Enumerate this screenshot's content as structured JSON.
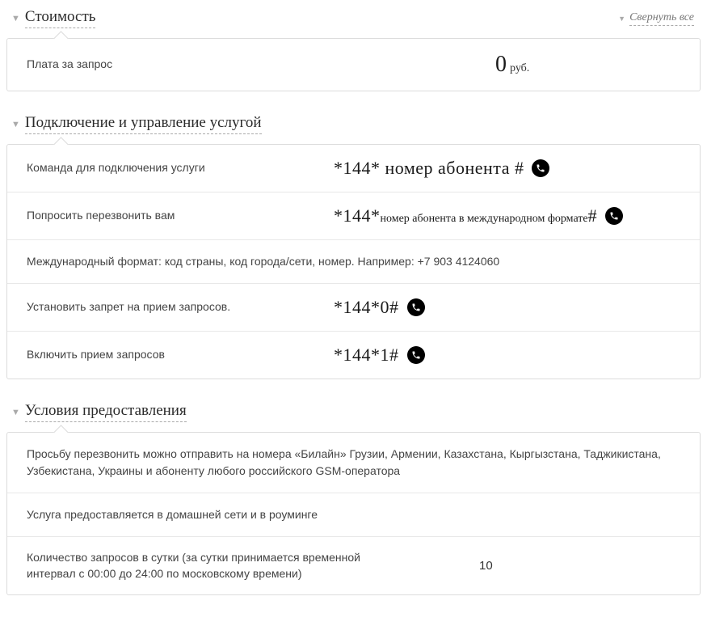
{
  "collapse_all": "Свернуть все",
  "sections": {
    "cost": {
      "title": "Стоимость",
      "rows": {
        "fee_label": "Плата за запрос",
        "fee_value": "0",
        "fee_unit": "руб."
      }
    },
    "manage": {
      "title": "Подключение и управление услугой",
      "rows": {
        "cmd_label": "Команда для подключения услуги",
        "cmd_code_a": "*144*",
        "cmd_code_b": "номер абонента",
        "cmd_code_c": "#",
        "callback_label": "Попросить перезвонить вам",
        "callback_code_a": "*144*",
        "callback_code_b": "номер абонента в международном формате",
        "callback_code_c": "#",
        "format_text": "Международный формат: код страны, код города/сети, номер. Например: +7 903 4124060",
        "block_label": "Установить запрет на прием запросов.",
        "block_code": "*144*0#",
        "enable_label": "Включить прием запросов",
        "enable_code": "*144*1#"
      }
    },
    "terms": {
      "title": "Условия предоставления",
      "rows": {
        "countries": "Просьбу перезвонить можно отправить на номера «Билайн» Грузии, Армении, Казахстана, Кыргызстана, Таджикистана, Узбекистана, Украины и абоненту любого российского GSM-оператора",
        "roaming": "Услуга предоставляется в домашней сети и в роуминге",
        "limit_label": "Количество запросов в сутки (за сутки принимается временной интервал с 00:00 до 24:00 по московскому времени)",
        "limit_value": "10"
      }
    }
  }
}
